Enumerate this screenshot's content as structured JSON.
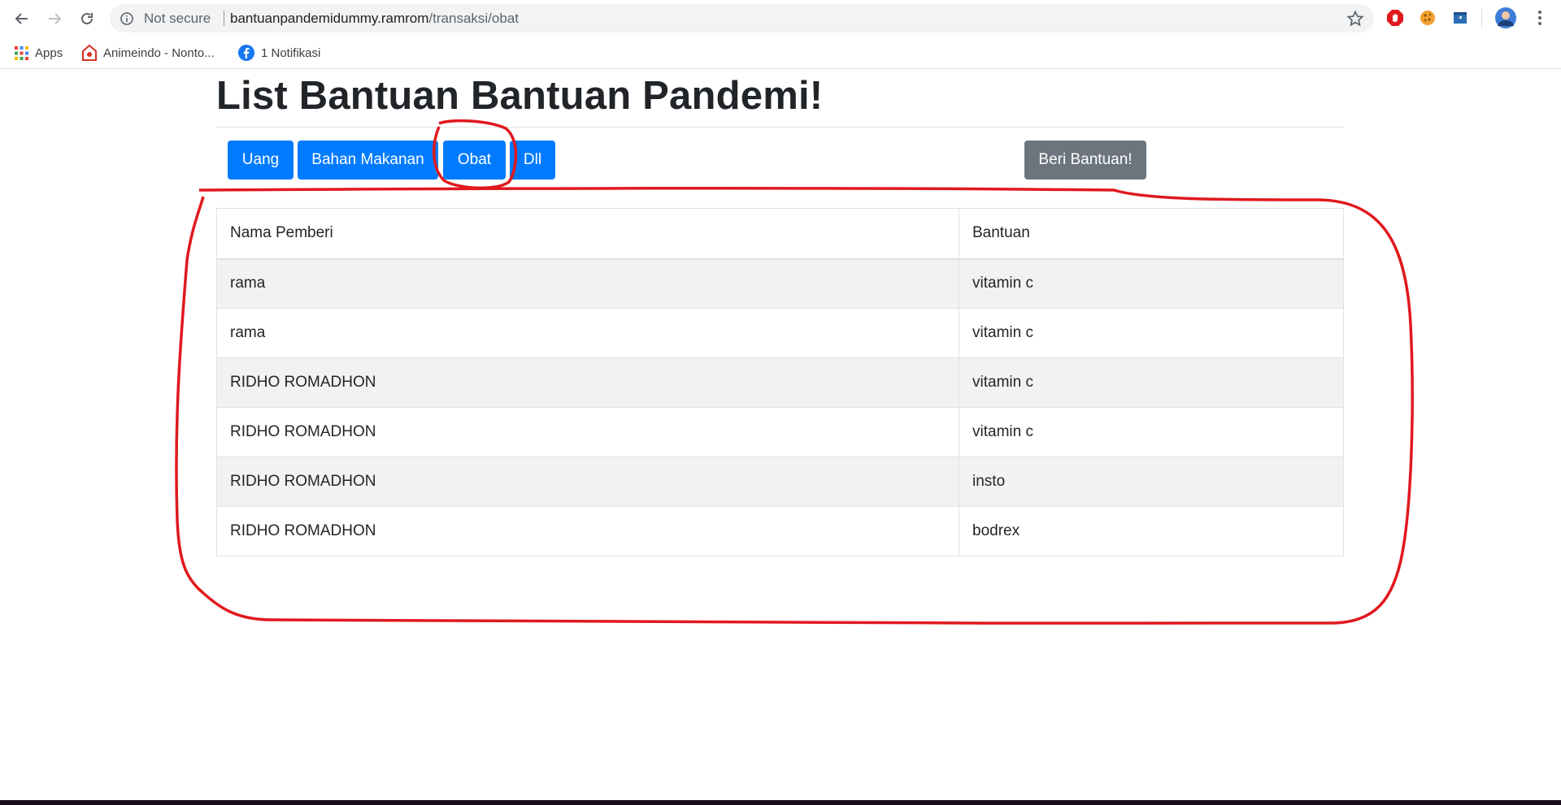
{
  "browser": {
    "security_label": "Not secure",
    "url_host": "bantuanpandemidummy.ramrom",
    "url_path": "/transaksi/obat",
    "bookmarks": [
      {
        "label": "Apps",
        "icon": "apps-grid-icon"
      },
      {
        "label": "Animeindo - Nonto...",
        "icon": "animeindo-icon"
      },
      {
        "label": "1 Notifikasi",
        "icon": "facebook-icon"
      }
    ]
  },
  "page": {
    "title": "List Bantuan Bantuan Pandemi!",
    "categories": [
      "Uang",
      "Bahan Makanan",
      "Obat",
      "Dll"
    ],
    "give_button": "Beri Bantuan!",
    "colors": {
      "primary": "#007bff",
      "secondary": "#6c757d",
      "annotation": "#e0191e"
    }
  },
  "table": {
    "headers": [
      "Nama Pemberi",
      "Bantuan"
    ],
    "rows": [
      [
        "rama",
        "vitamin c"
      ],
      [
        "rama",
        "vitamin c"
      ],
      [
        "RIDHO ROMADHON",
        "vitamin c"
      ],
      [
        "RIDHO ROMADHON",
        "vitamin c"
      ],
      [
        "RIDHO ROMADHON",
        "insto"
      ],
      [
        "RIDHO ROMADHON",
        "bodrex"
      ]
    ]
  }
}
